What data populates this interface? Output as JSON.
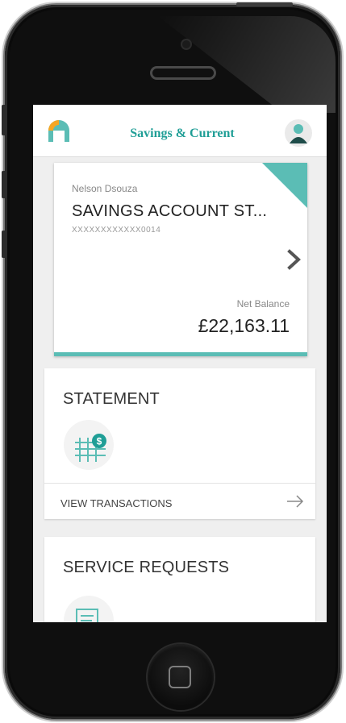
{
  "app": {
    "title": "Savings & Current"
  },
  "account": {
    "holder": "Nelson Dsouza",
    "name": "SAVINGS ACCOUNT ST...",
    "number": "XXXXXXXXXXXX0014",
    "net_balance_label": "Net Balance",
    "net_balance": "£22,163.11"
  },
  "statement": {
    "title": "STATEMENT",
    "view_transactions": "VIEW TRANSACTIONS"
  },
  "service_requests": {
    "title": "SERVICE REQUESTS"
  },
  "colors": {
    "accent": "#5bbdb5",
    "title": "#1f9e96",
    "logo_orange": "#f6a623"
  },
  "icons": [
    "logo-icon",
    "profile-icon",
    "chevron-right-icon",
    "statement-icon",
    "arrow-right-icon",
    "service-request-icon",
    "home-button-icon"
  ]
}
